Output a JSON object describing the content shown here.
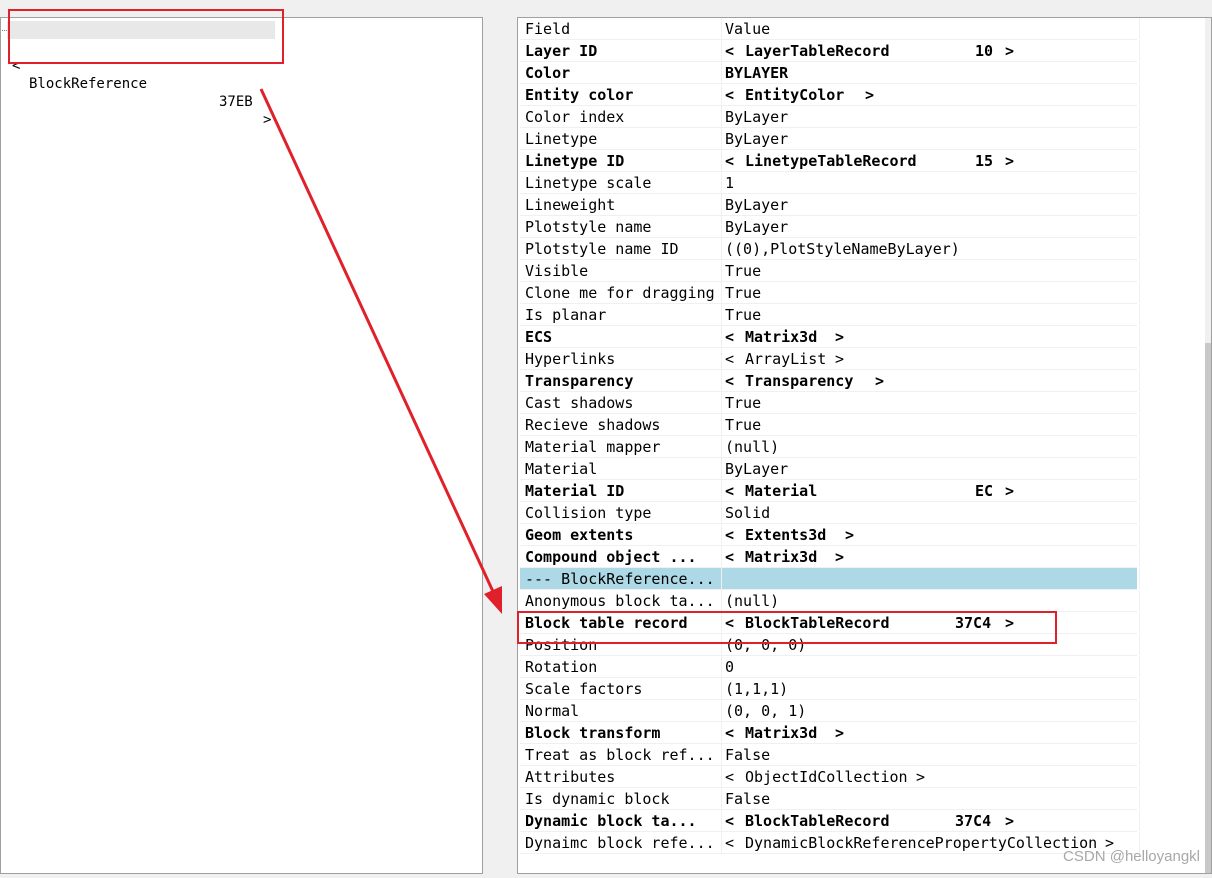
{
  "tree": {
    "node": {
      "name": "BlockReference",
      "handle": "37EB"
    }
  },
  "grid": {
    "header": {
      "field": "Field",
      "value": "Value"
    },
    "rows": [
      {
        "field": "Layer ID",
        "value": "LayerTableRecord",
        "handle": "10",
        "bold": true,
        "object": true
      },
      {
        "field": "Color",
        "value": "BYLAYER",
        "bold": true
      },
      {
        "field": "Entity color",
        "value": "EntityColor",
        "bold": true,
        "object": true
      },
      {
        "field": "Color index",
        "value": "ByLayer"
      },
      {
        "field": "Linetype",
        "value": "ByLayer"
      },
      {
        "field": "Linetype ID",
        "value": "LinetypeTableRecord",
        "handle": "15",
        "bold": true,
        "object": true
      },
      {
        "field": "Linetype scale",
        "value": "1"
      },
      {
        "field": "Lineweight",
        "value": "ByLayer"
      },
      {
        "field": "Plotstyle name",
        "value": "ByLayer"
      },
      {
        "field": "Plotstyle name ID",
        "value": "((0),PlotStyleNameByLayer)"
      },
      {
        "field": "Visible",
        "value": "True"
      },
      {
        "field": "Clone me for dragging",
        "value": "True"
      },
      {
        "field": "Is planar",
        "value": "True"
      },
      {
        "field": "ECS",
        "value": "Matrix3d",
        "bold": true,
        "object": true
      },
      {
        "field": "Hyperlinks",
        "value": "ArrayList",
        "object": true
      },
      {
        "field": "Transparency",
        "value": "Transparency",
        "bold": true,
        "object": true
      },
      {
        "field": "Cast shadows",
        "value": "True"
      },
      {
        "field": "Recieve shadows",
        "value": "True"
      },
      {
        "field": "Material mapper",
        "value": "(null)"
      },
      {
        "field": "Material",
        "value": "ByLayer"
      },
      {
        "field": "Material ID",
        "value": "Material",
        "handle": "EC",
        "bold": true,
        "object": true
      },
      {
        "field": "Collision type",
        "value": "Solid"
      },
      {
        "field": "Geom extents",
        "value": "Extents3d",
        "bold": true,
        "object": true
      },
      {
        "field": "Compound object ...",
        "value": "Matrix3d",
        "bold": true,
        "object": true
      },
      {
        "field": "--- BlockReference...",
        "value": "",
        "selected": true
      },
      {
        "field": "Anonymous block ta...",
        "value": "(null)"
      },
      {
        "field": "Block table record",
        "value": "BlockTableRecord",
        "handle": "37C4",
        "bold": true,
        "object": true
      },
      {
        "field": "Position",
        "value": "(0, 0, 0)"
      },
      {
        "field": "Rotation",
        "value": "0"
      },
      {
        "field": "Scale factors",
        "value": "(1,1,1)"
      },
      {
        "field": "Normal",
        "value": "(0, 0, 1)"
      },
      {
        "field": "Block transform",
        "value": "Matrix3d",
        "bold": true,
        "object": true
      },
      {
        "field": "Treat as block ref...",
        "value": "False"
      },
      {
        "field": "Attributes",
        "value": "ObjectIdCollection",
        "object": true
      },
      {
        "field": "Is dynamic block",
        "value": "False"
      },
      {
        "field": "Dynamic block ta...",
        "value": "BlockTableRecord",
        "handle": "37C4",
        "bold": true,
        "object": true
      },
      {
        "field": "Dynaimc block refe...",
        "value": "DynamicBlockReferencePropertyCollection",
        "object": true
      }
    ]
  },
  "colors": {
    "selection": "#add8e6",
    "annotation": "#e0202a"
  },
  "watermark": "CSDN @helloyangkl"
}
